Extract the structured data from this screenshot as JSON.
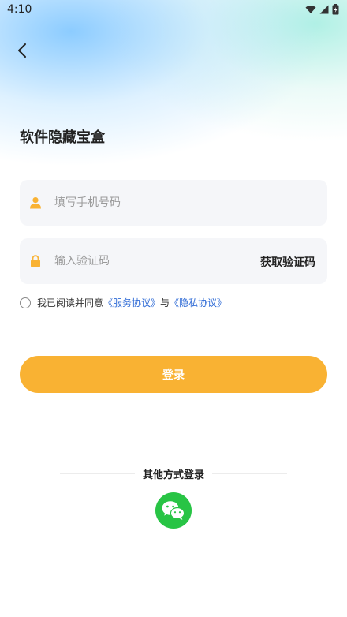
{
  "status_bar": {
    "time": "4:10",
    "icons": [
      "wifi-icon",
      "signal-icon",
      "battery-icon"
    ]
  },
  "header": {
    "back_icon": "chevron-left-icon",
    "title": "软件隐藏宝盒"
  },
  "form": {
    "phone": {
      "icon": "user-icon",
      "placeholder": "填写手机号码",
      "value": ""
    },
    "code": {
      "icon": "lock-icon",
      "placeholder": "输入验证码",
      "value": "",
      "get_code_label": "获取验证码"
    }
  },
  "agreement": {
    "checked": false,
    "prefix": "我已阅读并同意",
    "service_link": "《服务协议》",
    "joiner": "与",
    "privacy_link": "《隐私协议》"
  },
  "login_button_label": "登录",
  "other_login": {
    "label": "其他方式登录",
    "methods": [
      "wechat-icon"
    ]
  },
  "colors": {
    "accent": "#f9b233",
    "link": "#2f6bd6",
    "wechat": "#28c445",
    "field_bg": "#f5f6f9"
  }
}
